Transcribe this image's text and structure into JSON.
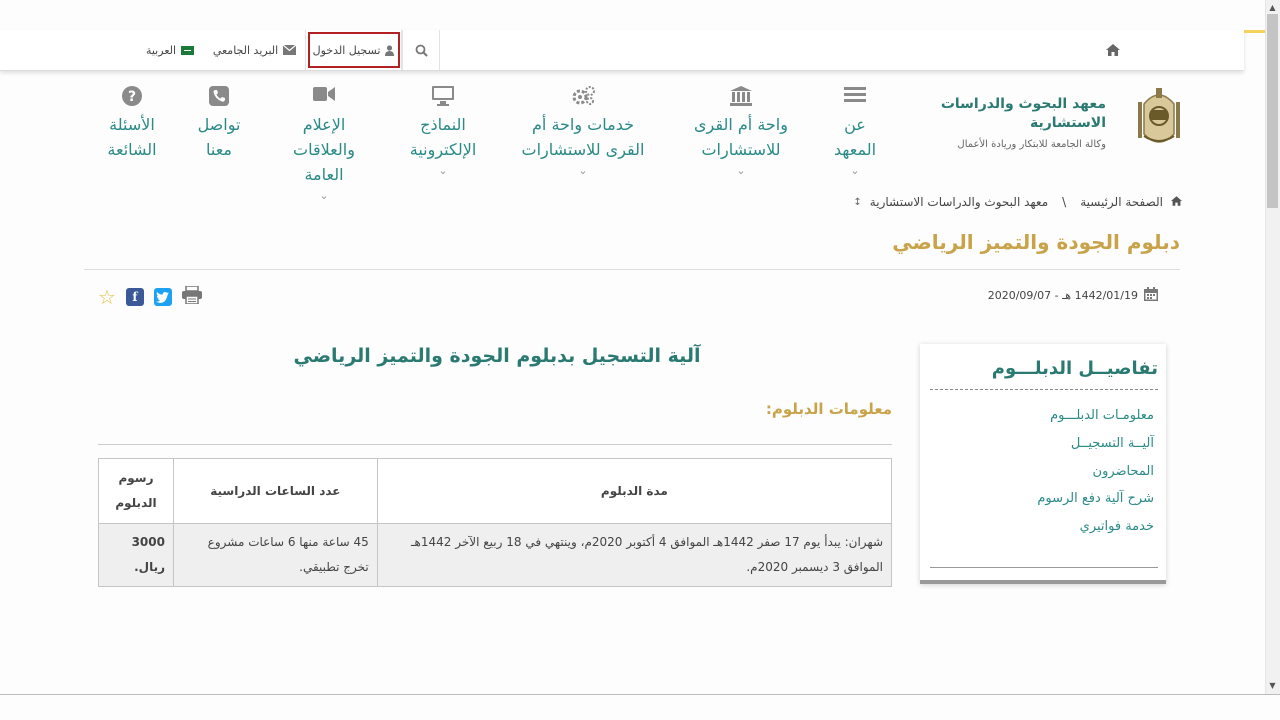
{
  "topbar": {
    "language": "العربية",
    "mail": "البريد الجامعي",
    "login": "تسجيل الدخول"
  },
  "logo": {
    "title": "معهد البحوث والدراسات الاستشارية",
    "subtitle": "وكالة الجامعة للابتكار وريادة الأعمال"
  },
  "nav": [
    {
      "label": "عن المعهد",
      "icon": "list-icon"
    },
    {
      "label": "واحة أم القرى للاستشارات",
      "icon": "institution-icon"
    },
    {
      "label": "خدمات واحة أم القرى للاستشارات",
      "icon": "gears-icon"
    },
    {
      "label": "النماذج الإلكترونية",
      "icon": "monitor-icon"
    },
    {
      "label": "الإعلام والعلاقات العامة",
      "icon": "video-camera-icon"
    },
    {
      "label": "تواصل معنا",
      "icon": "phone-icon"
    },
    {
      "label": "الأسئلة الشائعة",
      "icon": "question-icon"
    }
  ],
  "breadcrumb": {
    "home": "الصفحة الرئيسية",
    "separator": "\\",
    "current": "معهد البحوث والدراسات الاستشارية"
  },
  "page": {
    "title": "دبلوم الجودة والتميز الرياضي",
    "date": "1442/01/19 هـ - 2020/09/07"
  },
  "sidebar": {
    "title": "تفاصيــل الدبلـــوم",
    "links": [
      "معلومـات الدبلـــوم",
      "آليــة التسجيــل",
      "المحاضرون",
      "شرح آلية دفع الرسوم",
      "خدمة فواتيري"
    ]
  },
  "content": {
    "heading": "آلية التسجيل بدبلوم الجودة والتميز الرياضي",
    "subheading": "معلومات الدبلوم:",
    "table": {
      "headers": [
        "مدة الدبلوم",
        "عدد الساعات الدراسية",
        "رسوم الدبلوم"
      ],
      "row": [
        "شهران: يبدأ يوم 17 صفر 1442هـ الموافق 4 أكتوبر 2020م، وينتهي في 18 ربيع الآخر 1442هـ الموافق 3 ديسمبر 2020م.",
        "45 ساعة منها 6 ساعات مشروع تخرج تطبيقي.",
        "3000 ريال."
      ]
    }
  },
  "colors": {
    "teal": "#2a7a72",
    "gold": "#c8a34a",
    "login_outline": "#b22222"
  }
}
